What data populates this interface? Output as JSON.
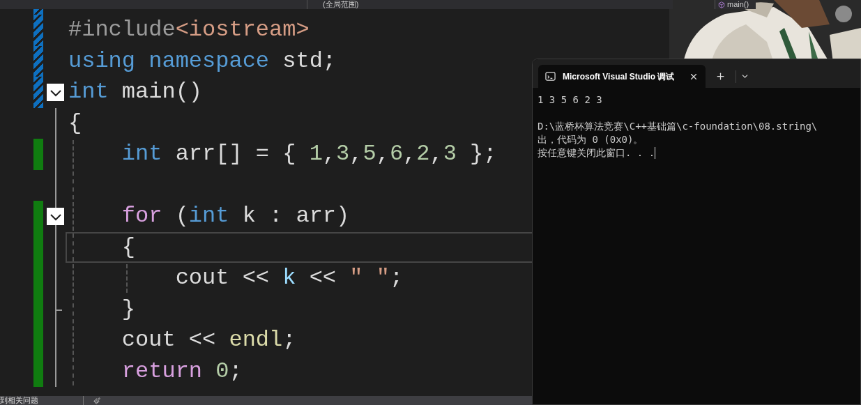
{
  "top_bar": {
    "scope_dropdown": "(全局范围)",
    "member_dropdown": "main()"
  },
  "editor": {
    "lines": [
      {
        "modified": true,
        "saved": true,
        "tokens": [
          {
            "text": "#include",
            "kind": "preprocessor"
          },
          {
            "text": "<iostream>",
            "kind": "string"
          }
        ]
      },
      {
        "modified": true,
        "saved": true,
        "tokens": [
          {
            "text": "using",
            "kind": "keyword"
          },
          {
            "text": " namespace",
            "kind": "keyword"
          },
          {
            "text": " std;",
            "kind": "plain"
          }
        ]
      },
      {
        "modified": true,
        "saved": true,
        "fold": {
          "expanded": true
        },
        "tokens": [
          {
            "text": "int",
            "kind": "keyword"
          },
          {
            "text": " main()",
            "kind": "plain"
          }
        ]
      },
      {
        "modified": false,
        "tokens": [
          {
            "text": "{",
            "kind": "plain"
          }
        ]
      },
      {
        "modified": true,
        "saved": false,
        "tokens": [
          {
            "text": "    int",
            "kind": "keyword"
          },
          {
            "text": " arr[] = { ",
            "kind": "plain"
          },
          {
            "text": "1",
            "kind": "number"
          },
          {
            "text": ",",
            "kind": "plain"
          },
          {
            "text": "3",
            "kind": "number"
          },
          {
            "text": ",",
            "kind": "plain"
          },
          {
            "text": "5",
            "kind": "number"
          },
          {
            "text": ",",
            "kind": "plain"
          },
          {
            "text": "6",
            "kind": "number"
          },
          {
            "text": ",",
            "kind": "plain"
          },
          {
            "text": "2",
            "kind": "number"
          },
          {
            "text": ",",
            "kind": "plain"
          },
          {
            "text": "3",
            "kind": "number"
          },
          {
            "text": " };",
            "kind": "plain"
          }
        ]
      },
      {
        "modified": false
      },
      {
        "modified": true,
        "saved": false,
        "fold": {
          "expanded": true
        },
        "tokens": [
          {
            "text": "    for",
            "kind": "control"
          },
          {
            "text": " (",
            "kind": "plain"
          },
          {
            "text": "int",
            "kind": "keyword"
          },
          {
            "text": " k : arr)",
            "kind": "plain"
          }
        ]
      },
      {
        "modified": true,
        "saved": false,
        "current": true,
        "tokens": [
          {
            "text": "    {",
            "kind": "plain"
          }
        ]
      },
      {
        "modified": true,
        "saved": false,
        "tokens": [
          {
            "text": "        cout << ",
            "kind": "plain"
          },
          {
            "text": "k",
            "kind": "variable"
          },
          {
            "text": " << ",
            "kind": "plain"
          },
          {
            "text": "\" \"",
            "kind": "string"
          },
          {
            "text": ";",
            "kind": "plain"
          }
        ]
      },
      {
        "modified": true,
        "saved": false,
        "block_end": true,
        "tokens": [
          {
            "text": "    }",
            "kind": "plain"
          }
        ]
      },
      {
        "modified": true,
        "saved": false,
        "tokens": [
          {
            "text": "    cout << ",
            "kind": "plain"
          },
          {
            "text": "endl",
            "kind": "function"
          },
          {
            "text": ";",
            "kind": "plain"
          }
        ]
      },
      {
        "modified": true,
        "saved": false,
        "tokens": [
          {
            "text": "    return",
            "kind": "control"
          },
          {
            "text": " 0",
            "kind": "number"
          },
          {
            "text": ";",
            "kind": "plain"
          }
        ]
      }
    ]
  },
  "console": {
    "tab_title": "Microsoft Visual Studio 调试",
    "paragraphs": [
      [
        "1 3 5 6 2 3"
      ],
      [
        "D:\\蓝桥杯算法竞赛\\C++基础篇\\c-foundation\\08.string\\",
        "出，代码为 0 (0x0)。",
        "按任意键关闭此窗口. . ."
      ]
    ]
  },
  "status_bar": {
    "issues": "到相关问题"
  }
}
